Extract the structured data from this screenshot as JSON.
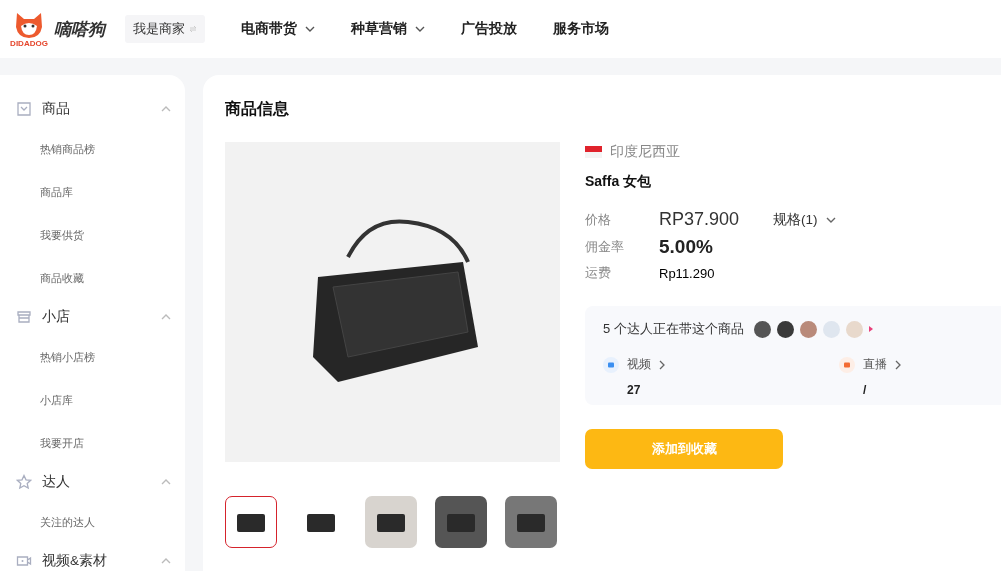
{
  "header": {
    "brand": "嘀嗒狗",
    "logo_caption": "DIDADOG",
    "role_switch": "我是商家",
    "nav": [
      {
        "label": "电商带货",
        "has_menu": true
      },
      {
        "label": "种草营销",
        "has_menu": true
      },
      {
        "label": "广告投放",
        "has_menu": false
      },
      {
        "label": "服务市场",
        "has_menu": false
      }
    ]
  },
  "sidebar": {
    "groups": [
      {
        "kind": "product",
        "label": "商品",
        "expanded": true,
        "items": [
          "热销商品榜",
          "商品库",
          "我要供货",
          "商品收藏"
        ]
      },
      {
        "kind": "shop",
        "label": "小店",
        "expanded": true,
        "items": [
          "热销小店榜",
          "小店库",
          "我要开店"
        ]
      },
      {
        "kind": "creator",
        "label": "达人",
        "expanded": true,
        "items": [
          "关注的达人"
        ]
      },
      {
        "kind": "video",
        "label": "视频&素材",
        "expanded": true
      }
    ]
  },
  "product": {
    "section_title": "商品信息",
    "thumbnails": [
      {
        "selected": true
      },
      {
        "selected": false
      },
      {
        "selected": false
      },
      {
        "selected": false
      },
      {
        "selected": false
      }
    ],
    "country": "印度尼西亚",
    "name": "Saffa 女包",
    "price_label": "价格",
    "price": "RP37.900",
    "spec": "规格(1)",
    "commission_label": "佣金率",
    "commission": "5.00%",
    "shipping_label": "运费",
    "shipping": "Rp11.290",
    "creators_text": "5 个达人正在带这个商品",
    "stats": [
      {
        "kind": "video",
        "label": "视频",
        "value": "27"
      },
      {
        "kind": "live",
        "label": "直播",
        "value": "/"
      }
    ],
    "favorite_button": "添加到收藏"
  }
}
